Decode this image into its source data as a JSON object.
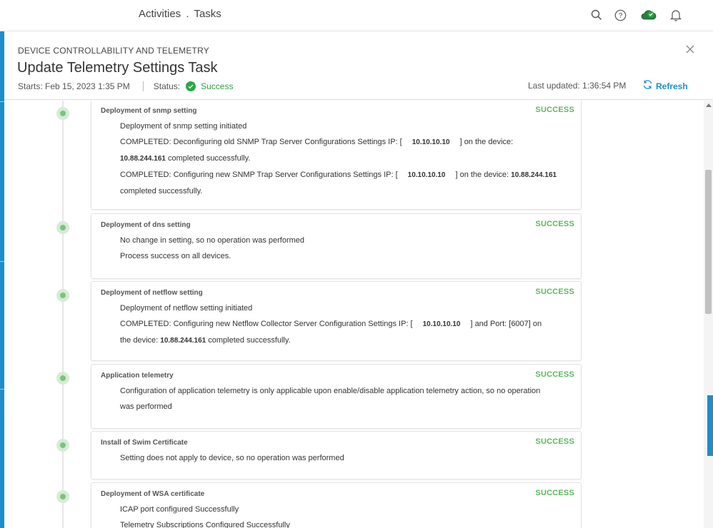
{
  "topbar": {
    "crumb_left": "Activities",
    "crumb_sep": ".",
    "crumb_right": "Tasks",
    "icons": [
      "search-icon",
      "help-icon",
      "cloud-status-icon",
      "bell-icon"
    ]
  },
  "panel": {
    "kicker": "DEVICE CONTROLLABILITY AND TELEMETRY",
    "title": "Update Telemetry Settings Task",
    "starts": "Starts: Feb 15, 2023 1:35 PM",
    "status_label": "Status:",
    "status_value": "Success",
    "last_updated": "Last updated: 1:36:54 PM",
    "refresh_label": "Refresh"
  },
  "cards": [
    {
      "title": "Deployment of snmp setting",
      "status": "SUCCESS",
      "line1": "Deployment of snmp setting initiated",
      "line2a": "COMPLETED: Deconfiguring old SNMP Trap Server Configurations Settings IP: [",
      "line2ip": "10.10.10.10",
      "line2b": "] on the device:",
      "line3ip": "10.88.244.161",
      "line3b": " completed successfully.",
      "line4a": "COMPLETED: Configuring new SNMP Trap Server Configurations Settings IP: [",
      "line4ip": "10.10.10.10",
      "line4b": "] on the device: ",
      "line4ip2": "10.88.244.161",
      "line5": "completed successfully."
    },
    {
      "title": "Deployment of dns setting",
      "status": "SUCCESS",
      "line1": "No change in setting, so no operation was performed",
      "line2": "Process success on all devices."
    },
    {
      "title": "Deployment of netflow setting",
      "status": "SUCCESS",
      "line1": "Deployment of netflow setting initiated",
      "line2a": "COMPLETED: Configuring new Netflow Collector Server Configuration Settings IP: [",
      "line2ip": "10.10.10.10",
      "line2b": "] and Port: [6007] on",
      "line3a": "the device: ",
      "line3ip": "10.88.244.161",
      "line3b": " completed successfully."
    },
    {
      "title": "Application telemetry",
      "status": "SUCCESS",
      "line1": "Configuration of application telemetry is only applicable upon enable/disable application telemetry action, so no operation",
      "line2": "was performed"
    },
    {
      "title": "Install of Swim Certificate",
      "status": "SUCCESS",
      "line1": "Setting does not apply to device, so no operation was performed"
    },
    {
      "title": "Deployment of WSA certificate",
      "status": "SUCCESS",
      "line1": "ICAP port configured Successfully",
      "line2": "Telemetry Subscriptions Configured Successfully"
    }
  ],
  "colors": {
    "accent": "#1f8dc9",
    "success": "#5cb85c",
    "status_dot": "#27a844"
  }
}
